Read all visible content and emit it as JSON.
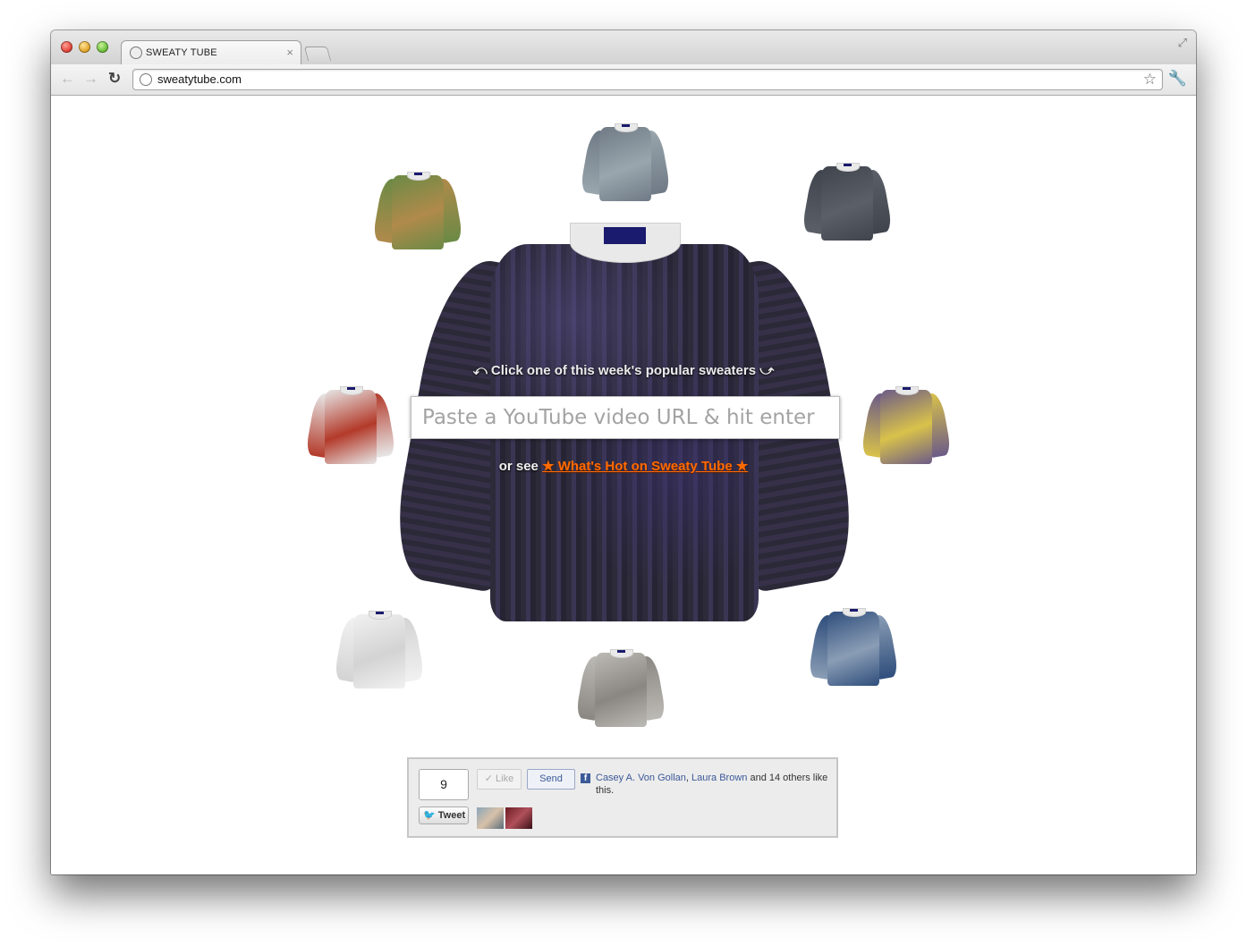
{
  "browser": {
    "tab_title": "SWEATY TUBE",
    "tab_close": "×",
    "url": "sweatytube.com",
    "back": "←",
    "forward": "→",
    "reload": "↻",
    "star": "☆",
    "wrench": "🔧",
    "fullscreen": "⤢"
  },
  "page": {
    "prompt": "⤺ Click one of this week's popular sweaters ⤻",
    "input_placeholder": "Paste a YouTube video URL & hit enter",
    "or_see": "or see ",
    "hot_link": "★ What's Hot on Sweaty Tube ★"
  },
  "sweaters": [
    {
      "name": "sweater-skyline",
      "colors": [
        "#6f7a86",
        "#9aa6ad"
      ]
    },
    {
      "name": "sweater-couple-park",
      "colors": [
        "#6b8a45",
        "#b08a4b"
      ]
    },
    {
      "name": "sweater-night-stage",
      "colors": [
        "#3f444d",
        "#5b6068"
      ]
    },
    {
      "name": "sweater-red-shirt",
      "colors": [
        "#e7e7e7",
        "#b33a2a"
      ]
    },
    {
      "name": "sweater-purple-desert",
      "colors": [
        "#6c5b88",
        "#d9c24a"
      ]
    },
    {
      "name": "sweater-white-logo",
      "colors": [
        "#f1f1f1",
        "#d3d3d3"
      ]
    },
    {
      "name": "sweater-blue-cliff",
      "colors": [
        "#2f4e7c",
        "#8a9db5"
      ]
    },
    {
      "name": "sweater-rhino",
      "colors": [
        "#bcbab5",
        "#8a8782"
      ]
    }
  ],
  "social": {
    "tweet_count": "9",
    "tweet_label": "Tweet",
    "tweet_icon": "twitter-bird",
    "like_label": "✓ Like",
    "send_label": "Send",
    "friend_1": "Casey A. Von Gollan",
    "separator": ", ",
    "friend_2": "Laura Brown",
    "others_text": " and 14 others like this."
  },
  "colors": {
    "hot_link": "#ff6a00",
    "facebook_blue": "#3b5998",
    "main_sweater": "#2e2b3b"
  }
}
